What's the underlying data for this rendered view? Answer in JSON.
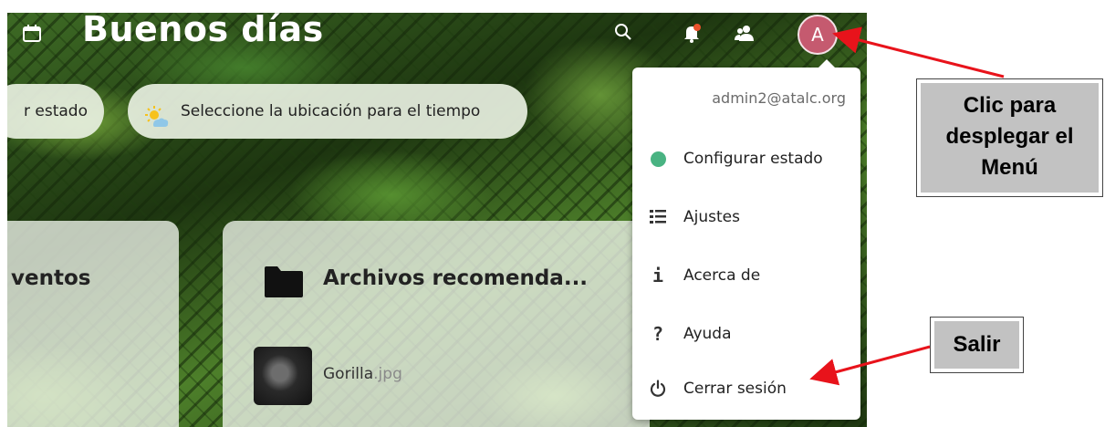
{
  "header": {
    "greeting": "Buenos días",
    "avatar_initial": "A",
    "icons": [
      "calendar-icon",
      "search-icon",
      "notifications-icon",
      "contacts-icon"
    ]
  },
  "status_bar": {
    "status_label": "r estado",
    "weather_label": "Seleccione la ubicación para el tiempo"
  },
  "panels": {
    "events_title": "ventos",
    "files_title": "Archivos recomenda...",
    "file": {
      "name": "Gorilla",
      "ext": ".jpg"
    }
  },
  "menu": {
    "email": "admin2@atalc.org",
    "items": [
      {
        "label": "Configurar estado",
        "icon": "status-dot-icon"
      },
      {
        "label": "Ajustes",
        "icon": "settings-list-icon"
      },
      {
        "label": "Acerca de",
        "icon": "info-icon"
      },
      {
        "label": "Ayuda",
        "icon": "help-icon"
      },
      {
        "label": "Cerrar sesión",
        "icon": "power-icon"
      }
    ],
    "status_color": "#49b382"
  },
  "callouts": {
    "menu_line1": "Clic para",
    "menu_line2": "desplegar el",
    "menu_line3": "Menú",
    "exit": "Salir"
  },
  "colors": {
    "avatar": "#c55a6f",
    "arrow": "#e8131b",
    "callout_bg": "#c2c2c2"
  }
}
